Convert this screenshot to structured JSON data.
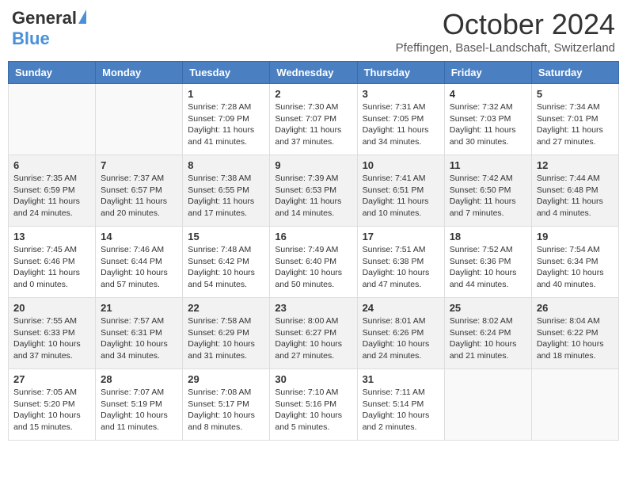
{
  "header": {
    "logo_general": "General",
    "logo_blue": "Blue",
    "title": "October 2024",
    "subtitle": "Pfeffingen, Basel-Landschaft, Switzerland"
  },
  "weekdays": [
    "Sunday",
    "Monday",
    "Tuesday",
    "Wednesday",
    "Thursday",
    "Friday",
    "Saturday"
  ],
  "weeks": [
    [
      {
        "day": "",
        "info": ""
      },
      {
        "day": "",
        "info": ""
      },
      {
        "day": "1",
        "info": "Sunrise: 7:28 AM\nSunset: 7:09 PM\nDaylight: 11 hours and 41 minutes."
      },
      {
        "day": "2",
        "info": "Sunrise: 7:30 AM\nSunset: 7:07 PM\nDaylight: 11 hours and 37 minutes."
      },
      {
        "day": "3",
        "info": "Sunrise: 7:31 AM\nSunset: 7:05 PM\nDaylight: 11 hours and 34 minutes."
      },
      {
        "day": "4",
        "info": "Sunrise: 7:32 AM\nSunset: 7:03 PM\nDaylight: 11 hours and 30 minutes."
      },
      {
        "day": "5",
        "info": "Sunrise: 7:34 AM\nSunset: 7:01 PM\nDaylight: 11 hours and 27 minutes."
      }
    ],
    [
      {
        "day": "6",
        "info": "Sunrise: 7:35 AM\nSunset: 6:59 PM\nDaylight: 11 hours and 24 minutes."
      },
      {
        "day": "7",
        "info": "Sunrise: 7:37 AM\nSunset: 6:57 PM\nDaylight: 11 hours and 20 minutes."
      },
      {
        "day": "8",
        "info": "Sunrise: 7:38 AM\nSunset: 6:55 PM\nDaylight: 11 hours and 17 minutes."
      },
      {
        "day": "9",
        "info": "Sunrise: 7:39 AM\nSunset: 6:53 PM\nDaylight: 11 hours and 14 minutes."
      },
      {
        "day": "10",
        "info": "Sunrise: 7:41 AM\nSunset: 6:51 PM\nDaylight: 11 hours and 10 minutes."
      },
      {
        "day": "11",
        "info": "Sunrise: 7:42 AM\nSunset: 6:50 PM\nDaylight: 11 hours and 7 minutes."
      },
      {
        "day": "12",
        "info": "Sunrise: 7:44 AM\nSunset: 6:48 PM\nDaylight: 11 hours and 4 minutes."
      }
    ],
    [
      {
        "day": "13",
        "info": "Sunrise: 7:45 AM\nSunset: 6:46 PM\nDaylight: 11 hours and 0 minutes."
      },
      {
        "day": "14",
        "info": "Sunrise: 7:46 AM\nSunset: 6:44 PM\nDaylight: 10 hours and 57 minutes."
      },
      {
        "day": "15",
        "info": "Sunrise: 7:48 AM\nSunset: 6:42 PM\nDaylight: 10 hours and 54 minutes."
      },
      {
        "day": "16",
        "info": "Sunrise: 7:49 AM\nSunset: 6:40 PM\nDaylight: 10 hours and 50 minutes."
      },
      {
        "day": "17",
        "info": "Sunrise: 7:51 AM\nSunset: 6:38 PM\nDaylight: 10 hours and 47 minutes."
      },
      {
        "day": "18",
        "info": "Sunrise: 7:52 AM\nSunset: 6:36 PM\nDaylight: 10 hours and 44 minutes."
      },
      {
        "day": "19",
        "info": "Sunrise: 7:54 AM\nSunset: 6:34 PM\nDaylight: 10 hours and 40 minutes."
      }
    ],
    [
      {
        "day": "20",
        "info": "Sunrise: 7:55 AM\nSunset: 6:33 PM\nDaylight: 10 hours and 37 minutes."
      },
      {
        "day": "21",
        "info": "Sunrise: 7:57 AM\nSunset: 6:31 PM\nDaylight: 10 hours and 34 minutes."
      },
      {
        "day": "22",
        "info": "Sunrise: 7:58 AM\nSunset: 6:29 PM\nDaylight: 10 hours and 31 minutes."
      },
      {
        "day": "23",
        "info": "Sunrise: 8:00 AM\nSunset: 6:27 PM\nDaylight: 10 hours and 27 minutes."
      },
      {
        "day": "24",
        "info": "Sunrise: 8:01 AM\nSunset: 6:26 PM\nDaylight: 10 hours and 24 minutes."
      },
      {
        "day": "25",
        "info": "Sunrise: 8:02 AM\nSunset: 6:24 PM\nDaylight: 10 hours and 21 minutes."
      },
      {
        "day": "26",
        "info": "Sunrise: 8:04 AM\nSunset: 6:22 PM\nDaylight: 10 hours and 18 minutes."
      }
    ],
    [
      {
        "day": "27",
        "info": "Sunrise: 7:05 AM\nSunset: 5:20 PM\nDaylight: 10 hours and 15 minutes."
      },
      {
        "day": "28",
        "info": "Sunrise: 7:07 AM\nSunset: 5:19 PM\nDaylight: 10 hours and 11 minutes."
      },
      {
        "day": "29",
        "info": "Sunrise: 7:08 AM\nSunset: 5:17 PM\nDaylight: 10 hours and 8 minutes."
      },
      {
        "day": "30",
        "info": "Sunrise: 7:10 AM\nSunset: 5:16 PM\nDaylight: 10 hours and 5 minutes."
      },
      {
        "day": "31",
        "info": "Sunrise: 7:11 AM\nSunset: 5:14 PM\nDaylight: 10 hours and 2 minutes."
      },
      {
        "day": "",
        "info": ""
      },
      {
        "day": "",
        "info": ""
      }
    ]
  ]
}
